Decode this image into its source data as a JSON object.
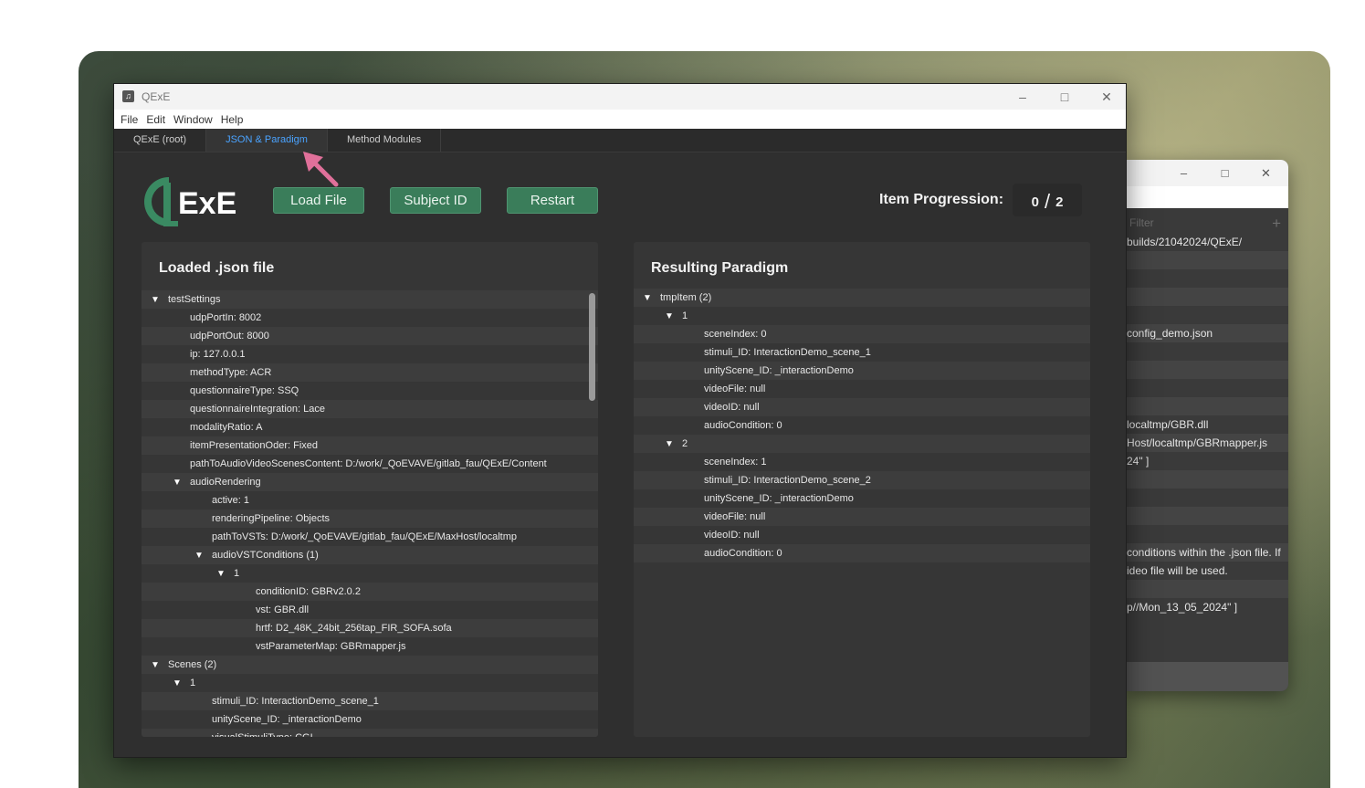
{
  "app": {
    "title": "QExE",
    "icon_name": "app-icon"
  },
  "menu": [
    "File",
    "Edit",
    "Window",
    "Help"
  ],
  "tabs": [
    {
      "label": "QExE (root)"
    },
    {
      "label": "JSON & Paradigm",
      "active": true
    },
    {
      "label": "Method Modules"
    }
  ],
  "toolbar": {
    "load_label": "Load File",
    "subject_label": "Subject ID",
    "restart_label": "Restart"
  },
  "progress": {
    "label": "Item Progression:",
    "current": "0",
    "slash": "/",
    "total": "2"
  },
  "left_panel": {
    "title": "Loaded .json file",
    "rows": [
      {
        "text": "testSettings",
        "level": 0,
        "arrow": true
      },
      {
        "text": "udpPortIn: 8002",
        "level": 1
      },
      {
        "text": "udpPortOut: 8000",
        "level": 1
      },
      {
        "text": "ip: 127.0.0.1",
        "level": 1
      },
      {
        "text": "methodType: ACR",
        "level": 1
      },
      {
        "text": "questionnaireType: SSQ",
        "level": 1
      },
      {
        "text": "questionnaireIntegration: Lace",
        "level": 1
      },
      {
        "text": "modalityRatio: A",
        "level": 1
      },
      {
        "text": "itemPresentationOder: Fixed",
        "level": 1
      },
      {
        "text": "pathToAudioVideoScenesContent: D:/work/_QoEVAVE/gitlab_fau/QExE/Content",
        "level": 1
      },
      {
        "text": "audioRendering",
        "level": 1,
        "arrow": true
      },
      {
        "text": "active: 1",
        "level": 2
      },
      {
        "text": "renderingPipeline: Objects",
        "level": 2
      },
      {
        "text": "pathToVSTs: D:/work/_QoEVAVE/gitlab_fau/QExE/MaxHost/localtmp",
        "level": 2
      },
      {
        "text": "audioVSTConditions (1)",
        "level": 2,
        "arrow": true
      },
      {
        "text": "1",
        "level": 3,
        "arrow": true
      },
      {
        "text": "conditionID: GBRv2.0.2",
        "level": 4
      },
      {
        "text": "vst: GBR.dll",
        "level": 4
      },
      {
        "text": "hrtf: D2_48K_24bit_256tap_FIR_SOFA.sofa",
        "level": 4
      },
      {
        "text": "vstParameterMap: GBRmapper.js",
        "level": 4
      },
      {
        "text": "Scenes (2)",
        "level": 0,
        "arrow": true
      },
      {
        "text": "1",
        "level": 1,
        "arrow": true
      },
      {
        "text": "stimuli_ID: InteractionDemo_scene_1",
        "level": 2
      },
      {
        "text": "unityScene_ID: _interactionDemo",
        "level": 2
      },
      {
        "text": "visualStimuliType: CGI",
        "level": 2
      }
    ]
  },
  "right_panel": {
    "title": "Resulting Paradigm",
    "rows": [
      {
        "text": "tmpItem (2)",
        "level": 0,
        "arrow": true
      },
      {
        "text": "1",
        "level": 1,
        "arrow": true
      },
      {
        "text": "sceneIndex: 0",
        "level": 2
      },
      {
        "text": "stimuli_ID: InteractionDemo_scene_1",
        "level": 2
      },
      {
        "text": "unityScene_ID: _interactionDemo",
        "level": 2
      },
      {
        "text": "videoFile: null",
        "level": 2
      },
      {
        "text": "videoID: null",
        "level": 2
      },
      {
        "text": "audioCondition: 0",
        "level": 2
      },
      {
        "text": "2",
        "level": 1,
        "arrow": true
      },
      {
        "text": "sceneIndex: 1",
        "level": 2
      },
      {
        "text": "stimuli_ID: InteractionDemo_scene_2",
        "level": 2
      },
      {
        "text": "unityScene_ID: _interactionDemo",
        "level": 2
      },
      {
        "text": "videoFile: null",
        "level": 2
      },
      {
        "text": "videoID: null",
        "level": 2
      },
      {
        "text": "audioCondition: 0",
        "level": 2
      }
    ]
  },
  "back_window": {
    "filter_placeholder": "Filter",
    "plus": "+",
    "rows": [
      "builds/21042024/QExE/",
      "",
      "",
      "",
      "",
      "config_demo.json",
      "",
      "",
      "",
      "",
      "localtmp/GBR.dll",
      "Host/localtmp/GBRmapper.js",
      "24\" ]",
      "",
      "",
      "",
      "",
      "conditions within the .json file. If",
      "ideo file will be used.",
      "",
      "p//Mon_13_05_2024\" ]"
    ]
  },
  "colors": {
    "accent_button": "#3a7d5a",
    "active_tab": "#4aa3ff",
    "pointer_arrow": "#e0709a"
  }
}
